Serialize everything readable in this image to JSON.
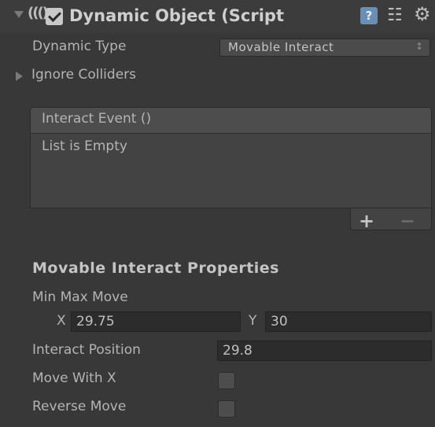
{
  "component": {
    "title": "Dynamic Object (Script",
    "enabled": true,
    "icons": [
      "script-icon",
      "help-icon",
      "preset-icon",
      "gear-icon"
    ],
    "help_glyph": "?"
  },
  "dynamic_type": {
    "label": "Dynamic Type",
    "value": "Movable Interact",
    "arrow": "↕"
  },
  "ignore_colliders": {
    "label": "Ignore Colliders",
    "expanded": false
  },
  "interact_event": {
    "header": "Interact Event ()",
    "empty_text": "List is Empty",
    "add_label": "+",
    "remove_label": "−"
  },
  "movable_props": {
    "title": "Movable Interact Properties",
    "min_max_move": {
      "label": "Min Max Move",
      "x_label": "X",
      "x_value": "29.75",
      "y_label": "Y",
      "y_value": "30"
    },
    "interact_position": {
      "label": "Interact Position",
      "value": "29.8"
    },
    "move_with_x": {
      "label": "Move With X",
      "checked": false
    },
    "reverse_move": {
      "label": "Reverse Move",
      "checked": false
    }
  },
  "colors": {
    "background": "#383838",
    "text": "#b4b4b4",
    "field": "#2c2c2c",
    "help_icon": "#6a8fb5"
  }
}
